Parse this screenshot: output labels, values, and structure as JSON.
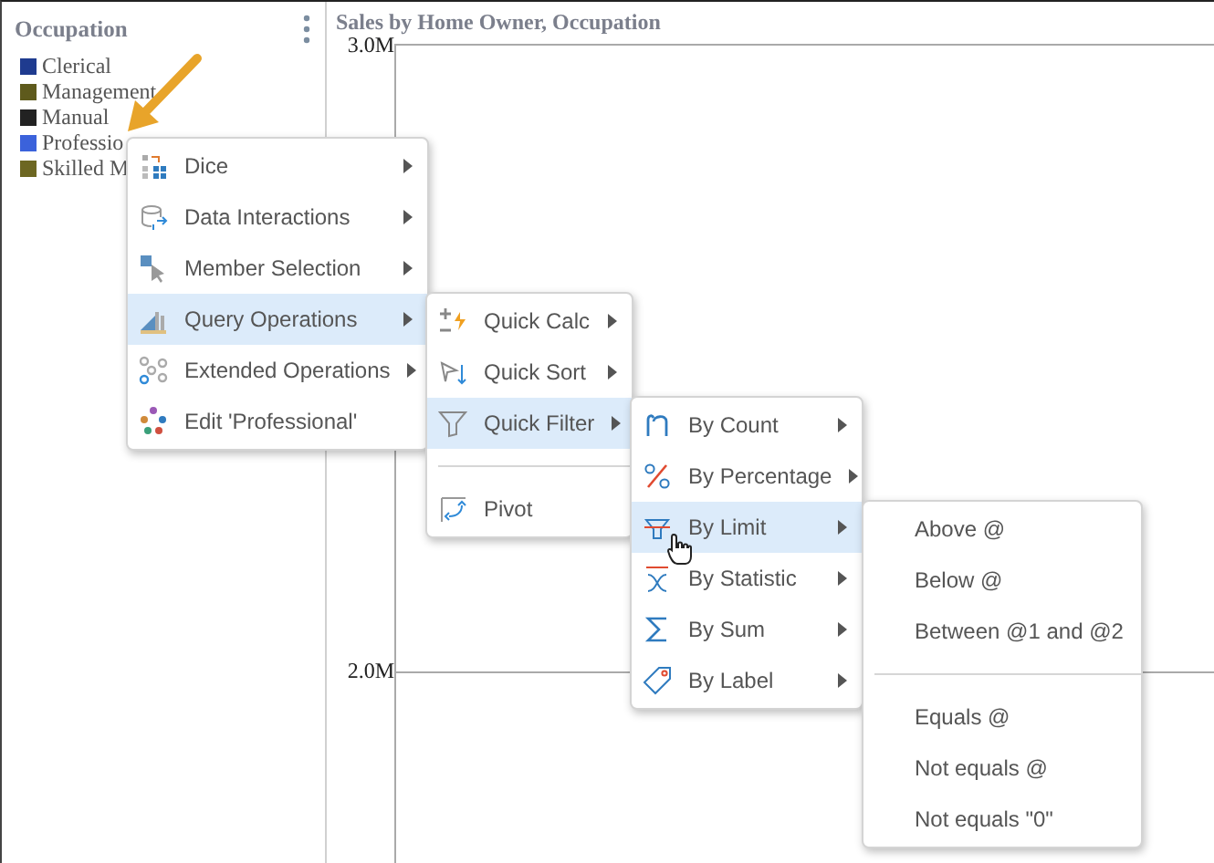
{
  "legend": {
    "title": "Occupation",
    "items": [
      {
        "label": "Clerical",
        "color": "#1f3b8f"
      },
      {
        "label": "Management",
        "color": "#5e5a1c"
      },
      {
        "label": "Manual",
        "color": "#222222"
      },
      {
        "label": "Professio",
        "color": "#3b62db"
      },
      {
        "label": "Skilled M",
        "color": "#6d6722"
      }
    ]
  },
  "chart": {
    "title": "Sales by Home Owner, Occupation",
    "y_labels": [
      "3.0M",
      "2.0M"
    ]
  },
  "menus": [
    {
      "items": [
        {
          "kind": "item",
          "label": "Dice",
          "submenu": true,
          "selected": false
        },
        {
          "kind": "item",
          "label": "Data Interactions",
          "submenu": true,
          "selected": false
        },
        {
          "kind": "item",
          "label": "Member Selection",
          "submenu": true,
          "selected": false
        },
        {
          "kind": "item",
          "label": "Query Operations",
          "submenu": true,
          "selected": true
        },
        {
          "kind": "item",
          "label": "Extended Operations",
          "submenu": true,
          "selected": false
        },
        {
          "kind": "item",
          "label": "Edit 'Professional'",
          "submenu": false,
          "selected": false
        }
      ]
    },
    {
      "items": [
        {
          "kind": "item",
          "label": "Quick Calc",
          "submenu": true,
          "selected": false
        },
        {
          "kind": "item",
          "label": "Quick Sort",
          "submenu": true,
          "selected": false
        },
        {
          "kind": "item",
          "label": "Quick Filter",
          "submenu": true,
          "selected": true
        },
        {
          "kind": "separator"
        },
        {
          "kind": "item",
          "label": "Pivot",
          "submenu": false,
          "selected": false
        }
      ]
    },
    {
      "items": [
        {
          "kind": "item",
          "label": "By Count",
          "submenu": true,
          "selected": false
        },
        {
          "kind": "item",
          "label": "By Percentage",
          "submenu": true,
          "selected": false
        },
        {
          "kind": "item",
          "label": "By Limit",
          "submenu": true,
          "selected": true
        },
        {
          "kind": "item",
          "label": "By Statistic",
          "submenu": true,
          "selected": false
        },
        {
          "kind": "item",
          "label": "By Sum",
          "submenu": true,
          "selected": false
        },
        {
          "kind": "item",
          "label": "By Label",
          "submenu": true,
          "selected": false
        }
      ]
    },
    {
      "items": [
        {
          "kind": "item",
          "label": "Above @",
          "submenu": false,
          "selected": false
        },
        {
          "kind": "item",
          "label": "Below @",
          "submenu": false,
          "selected": false
        },
        {
          "kind": "item",
          "label": "Between @1 and @2",
          "submenu": false,
          "selected": false
        },
        {
          "kind": "separator"
        },
        {
          "kind": "item",
          "label": "Equals @",
          "submenu": false,
          "selected": false
        },
        {
          "kind": "item",
          "label": "Not equals @",
          "submenu": false,
          "selected": false
        },
        {
          "kind": "item",
          "label": "Not equals \"0\"",
          "submenu": false,
          "selected": false
        }
      ]
    }
  ]
}
